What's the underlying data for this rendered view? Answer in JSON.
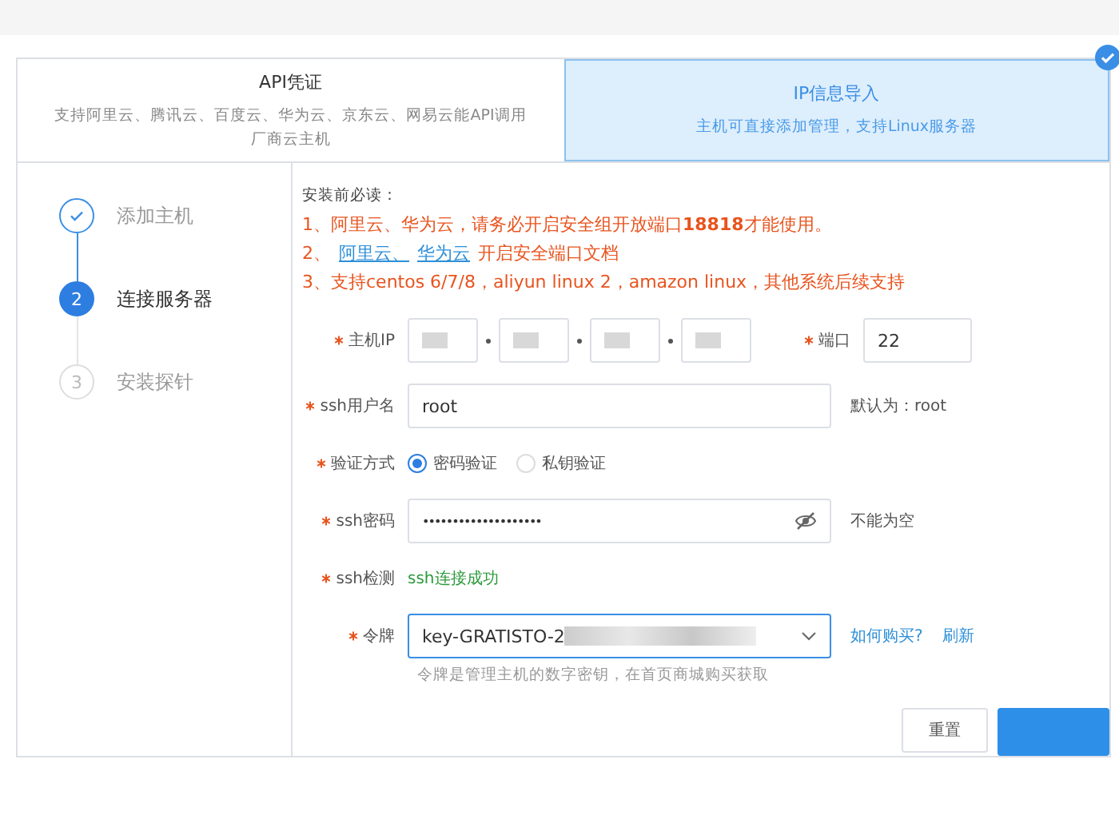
{
  "tabs": [
    {
      "title": "API凭证",
      "description": "支持阿里云、腾讯云、百度云、华为云、京东云、网易云能API调用厂商云主机",
      "selected": false
    },
    {
      "title": "IP信息导入",
      "description": "主机可直接添加管理，支持Linux服务器",
      "selected": true
    }
  ],
  "steps": [
    {
      "label": "添加主机",
      "kind": "done"
    },
    {
      "number": "2",
      "label": "连接服务器",
      "kind": "current"
    },
    {
      "number": "3",
      "label": "安装探针",
      "kind": "pending"
    }
  ],
  "notice": {
    "heading": "安装前必读：",
    "line_1": "1、阿里云、华为云，请务必开启安全组开放端口**18818**才能使用。",
    "line_2_prefix": "2、",
    "links": [
      "阿里云、",
      "华为云"
    ],
    "line_2_suffix": "开启安全端口文档",
    "line_3": "3、支持centos 6/7/8，aliyun linux 2，amazon linux，其他系统后续支持"
  },
  "form": {
    "ip_label": "主机IP",
    "port_label": "端口",
    "port_value": "22",
    "user_label": "ssh用户名",
    "user_value": "root",
    "user_hint": "默认为：root",
    "auth_label": "验证方式",
    "auth_options": [
      {
        "label": "密码验证",
        "selected": true
      },
      {
        "label": "私钥验证",
        "selected": false
      }
    ],
    "password_label": "ssh密码",
    "password_value": "••••••••••••••••••••",
    "password_hint": "不能为空",
    "check_label": "ssh检测",
    "check_result": "ssh连接成功",
    "token_label": "令牌",
    "token_value": "key-GRATISTO-2",
    "token_links": [
      "如何购买?",
      "刷新"
    ],
    "token_hint": "令牌是管理主机的数字密钥，在首页商城购买获取"
  },
  "buttons": {
    "reset": "重置"
  }
}
